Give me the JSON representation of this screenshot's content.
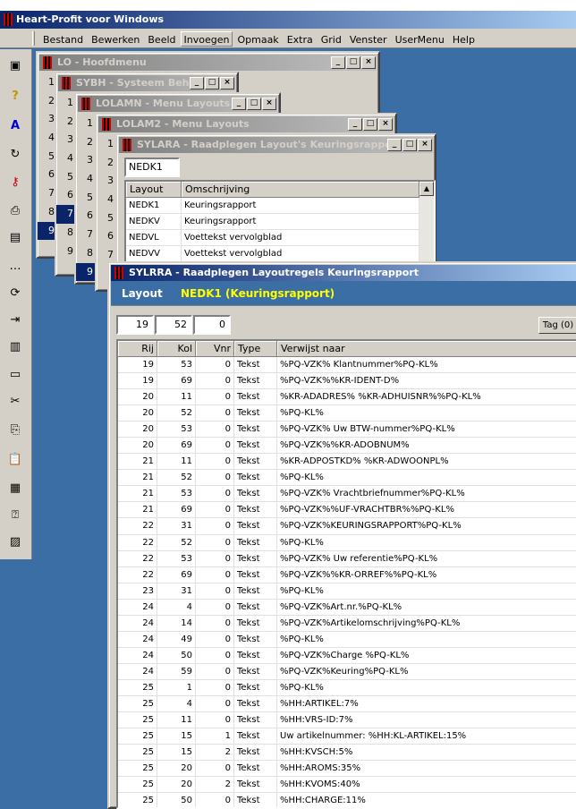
{
  "app": {
    "title": "Heart-Profit voor Windows"
  },
  "menu": [
    "Bestand",
    "Bewerken",
    "Beeld",
    "Invoegen",
    "Opmaak",
    "Extra",
    "Grid",
    "Venster",
    "UserMenu",
    "Help"
  ],
  "toolbar_icons": [
    "window-icon",
    "help-icon",
    "font-icon",
    "refresh-icon",
    "key-icon",
    "printer-icon",
    "grid-icon",
    "ellipsis-icon",
    "sync-icon",
    "export-icon",
    "chart-icon",
    "window-small-icon",
    "cut-icon",
    "copy-icon",
    "paste-icon",
    "clipboard-icon",
    "clipboard-help-icon",
    "network-icon"
  ],
  "windows": {
    "lo": {
      "title": "LO - Hoofdmenu",
      "nums": [
        "1",
        "2",
        "3",
        "4",
        "5",
        "6",
        "7",
        "8",
        "9"
      ]
    },
    "sybh": {
      "title": "SYBH - Systeem Behe...",
      "nums": [
        "1",
        "2",
        "3",
        "4",
        "5",
        "6",
        "7",
        "8",
        "9"
      ]
    },
    "lolamn": {
      "title": "LOLAMN - Menu Layouts",
      "nums": [
        "1",
        "2",
        "3",
        "4",
        "5",
        "6",
        "7",
        "8",
        "9"
      ]
    },
    "lolam2": {
      "title": "LOLAM2 - Menu Layouts",
      "nums": [
        "1",
        "2",
        "3",
        "4",
        "5",
        "6",
        "7"
      ]
    },
    "sylara": {
      "title": "SYLARA - Raadplegen Layout's Keuringsrapport",
      "search_value": "NEDK1",
      "headers": [
        "Layout",
        "Omschrijving"
      ],
      "rows": [
        [
          "NEDK1",
          "Keuringsrapport"
        ],
        [
          "NEDKV",
          "Keuringsrapport"
        ],
        [
          "NEDVL",
          "Voettekst vervolgblad"
        ],
        [
          "NEDVV",
          "Voettekst vervolgblad"
        ]
      ]
    },
    "sylrra": {
      "title": "SYLRRA - Raadplegen Layoutregels Keuringsrapport",
      "layout_label": "Layout",
      "layout_value": "NEDK1  (Keuringsrapport)",
      "fields": [
        "19",
        "52",
        "0"
      ],
      "tag_button": "Tag (0)",
      "headers": [
        "Rij",
        "Kol",
        "Vnr",
        "Type",
        "Verwijst naar"
      ],
      "rows": [
        [
          "19",
          "53",
          "0",
          "Tekst",
          "%PQ-VZK% Klantnummer%PQ-KL%"
        ],
        [
          "19",
          "69",
          "0",
          "Tekst",
          "%PQ-VZK%%KR-IDENT-D%"
        ],
        [
          "20",
          "11",
          "0",
          "Tekst",
          "%KR-ADADRES% %KR-ADHUISNR%%PQ-KL%"
        ],
        [
          "20",
          "52",
          "0",
          "Tekst",
          "%PQ-KL%"
        ],
        [
          "20",
          "53",
          "0",
          "Tekst",
          "%PQ-VZK% Uw BTW-nummer%PQ-KL%"
        ],
        [
          "20",
          "69",
          "0",
          "Tekst",
          "%PQ-VZK%%KR-ADOBNUM%"
        ],
        [
          "21",
          "11",
          "0",
          "Tekst",
          "%KR-ADPOSTKD%  %KR-ADWOONPL%"
        ],
        [
          "21",
          "52",
          "0",
          "Tekst",
          "%PQ-KL%"
        ],
        [
          "21",
          "53",
          "0",
          "Tekst",
          "%PQ-VZK% Vrachtbriefnummer%PQ-KL%"
        ],
        [
          "21",
          "69",
          "0",
          "Tekst",
          "%PQ-VZK%%UF-VRACHTBR%%PQ-KL%"
        ],
        [
          "22",
          "31",
          "0",
          "Tekst",
          "%PQ-VZK%KEURINGSRAPPORT%PQ-KL%"
        ],
        [
          "22",
          "52",
          "0",
          "Tekst",
          "%PQ-KL%"
        ],
        [
          "22",
          "53",
          "0",
          "Tekst",
          "%PQ-VZK% Uw referentie%PQ-KL%"
        ],
        [
          "22",
          "69",
          "0",
          "Tekst",
          "%PQ-VZK%%KR-ORREF%%PQ-KL%"
        ],
        [
          "23",
          "31",
          "0",
          "Tekst",
          "%PQ-KL%"
        ],
        [
          "24",
          "4",
          "0",
          "Tekst",
          "%PQ-VZK%Art.nr.%PQ-KL%"
        ],
        [
          "24",
          "14",
          "0",
          "Tekst",
          "%PQ-VZK%Artikelomschrijving%PQ-KL%"
        ],
        [
          "24",
          "49",
          "0",
          "Tekst",
          "%PQ-KL%"
        ],
        [
          "24",
          "50",
          "0",
          "Tekst",
          "%PQ-VZK%Charge %PQ-KL%"
        ],
        [
          "24",
          "59",
          "0",
          "Tekst",
          "%PQ-VZK%Keuring%PQ-KL%"
        ],
        [
          "25",
          "1",
          "0",
          "Tekst",
          "%PQ-KL%"
        ],
        [
          "25",
          "4",
          "0",
          "Tekst",
          "%HH:ARTIKEL:7%"
        ],
        [
          "25",
          "11",
          "0",
          "Tekst",
          "%HH:VRS-ID:7%"
        ],
        [
          "25",
          "15",
          "1",
          "Tekst",
          "Uw artikelnummer: %HH:KL-ARTIKEL:15%"
        ],
        [
          "25",
          "15",
          "2",
          "Tekst",
          "%HH:KVSCH:5%"
        ],
        [
          "25",
          "20",
          "0",
          "Tekst",
          "%HH:AROMS:35%"
        ],
        [
          "25",
          "20",
          "2",
          "Tekst",
          "%HH:KVOMS:40%"
        ],
        [
          "25",
          "50",
          "0",
          "Tekst",
          "%HH:CHARGE:11%"
        ]
      ]
    }
  }
}
